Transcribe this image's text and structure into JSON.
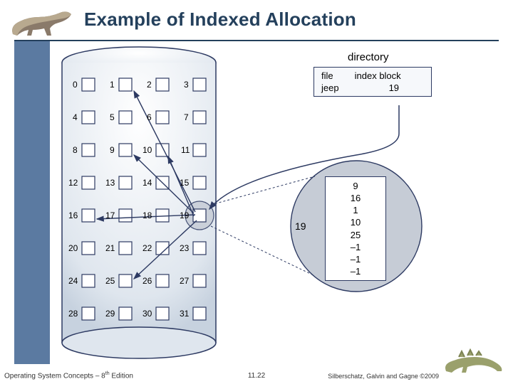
{
  "title": "Example of Indexed Allocation",
  "directory": {
    "label": "directory",
    "headers": {
      "file": "file",
      "index": "index block"
    },
    "entry": {
      "file": "jeep",
      "index": "19"
    }
  },
  "cylinder": {
    "rows": 8,
    "cols": 4,
    "labels": [
      "0",
      "1",
      "2",
      "3",
      "4",
      "5",
      "6",
      "7",
      "8",
      "9",
      "10",
      "11",
      "12",
      "13",
      "14",
      "15",
      "16",
      "17",
      "18",
      "19",
      "20",
      "21",
      "22",
      "23",
      "24",
      "25",
      "26",
      "27",
      "28",
      "29",
      "30",
      "31"
    ]
  },
  "index_block": {
    "number": "19",
    "entries": [
      "9",
      "16",
      "1",
      "10",
      "25",
      "–1",
      "–1",
      "–1"
    ]
  },
  "footer": {
    "left_a": "Operating System Concepts – 8",
    "left_sup": "th",
    "left_b": " Edition",
    "center": "11.22",
    "right": "Silberschatz, Galvin and Gagne ©2009"
  }
}
